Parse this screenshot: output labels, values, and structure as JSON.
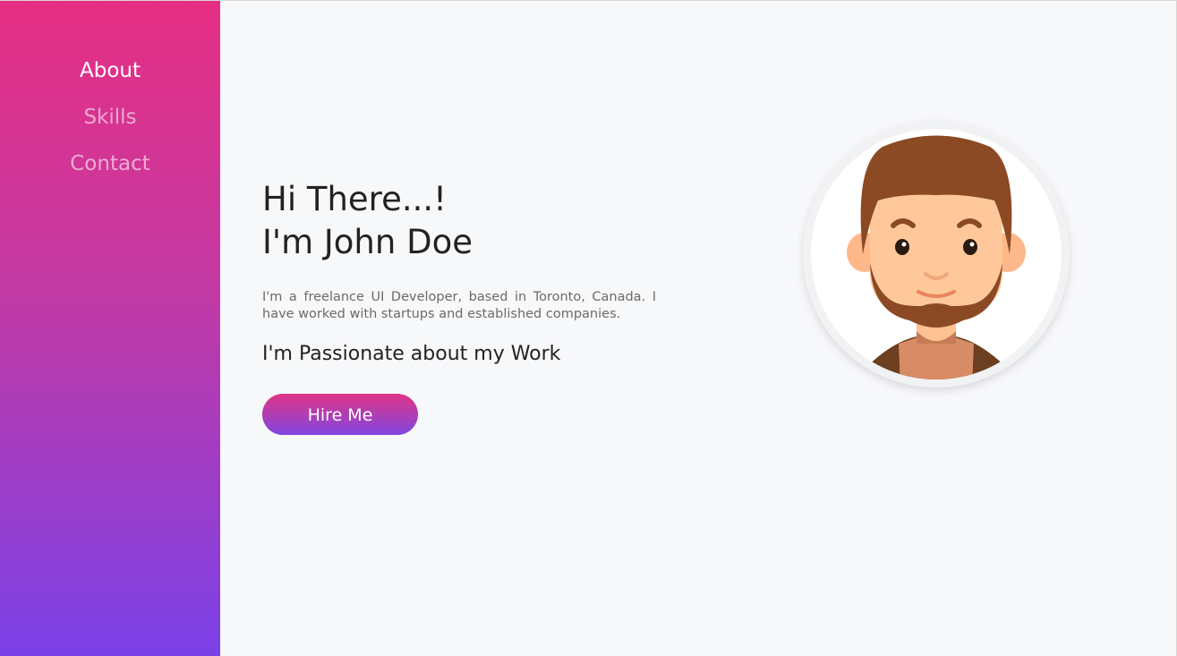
{
  "nav": {
    "items": [
      {
        "label": "About",
        "active": true
      },
      {
        "label": "Skills",
        "active": false
      },
      {
        "label": "Contact",
        "active": false
      }
    ]
  },
  "hero": {
    "greeting": "Hi There...!",
    "name_line": "I'm John Doe",
    "bio": "I'm a freelance UI Developer, based in Toronto, Canada. I have worked with startups and established companies.",
    "passion": "I'm Passionate about my Work",
    "cta_label": "Hire Me"
  },
  "avatar": {
    "icon": "avatar-illustration"
  },
  "colors": {
    "sidebar_top": "#e62f83",
    "sidebar_bottom": "#7a40e8",
    "background": "#f7f8fa",
    "hair": "#8b4a23",
    "skin": "#ffc89a"
  }
}
